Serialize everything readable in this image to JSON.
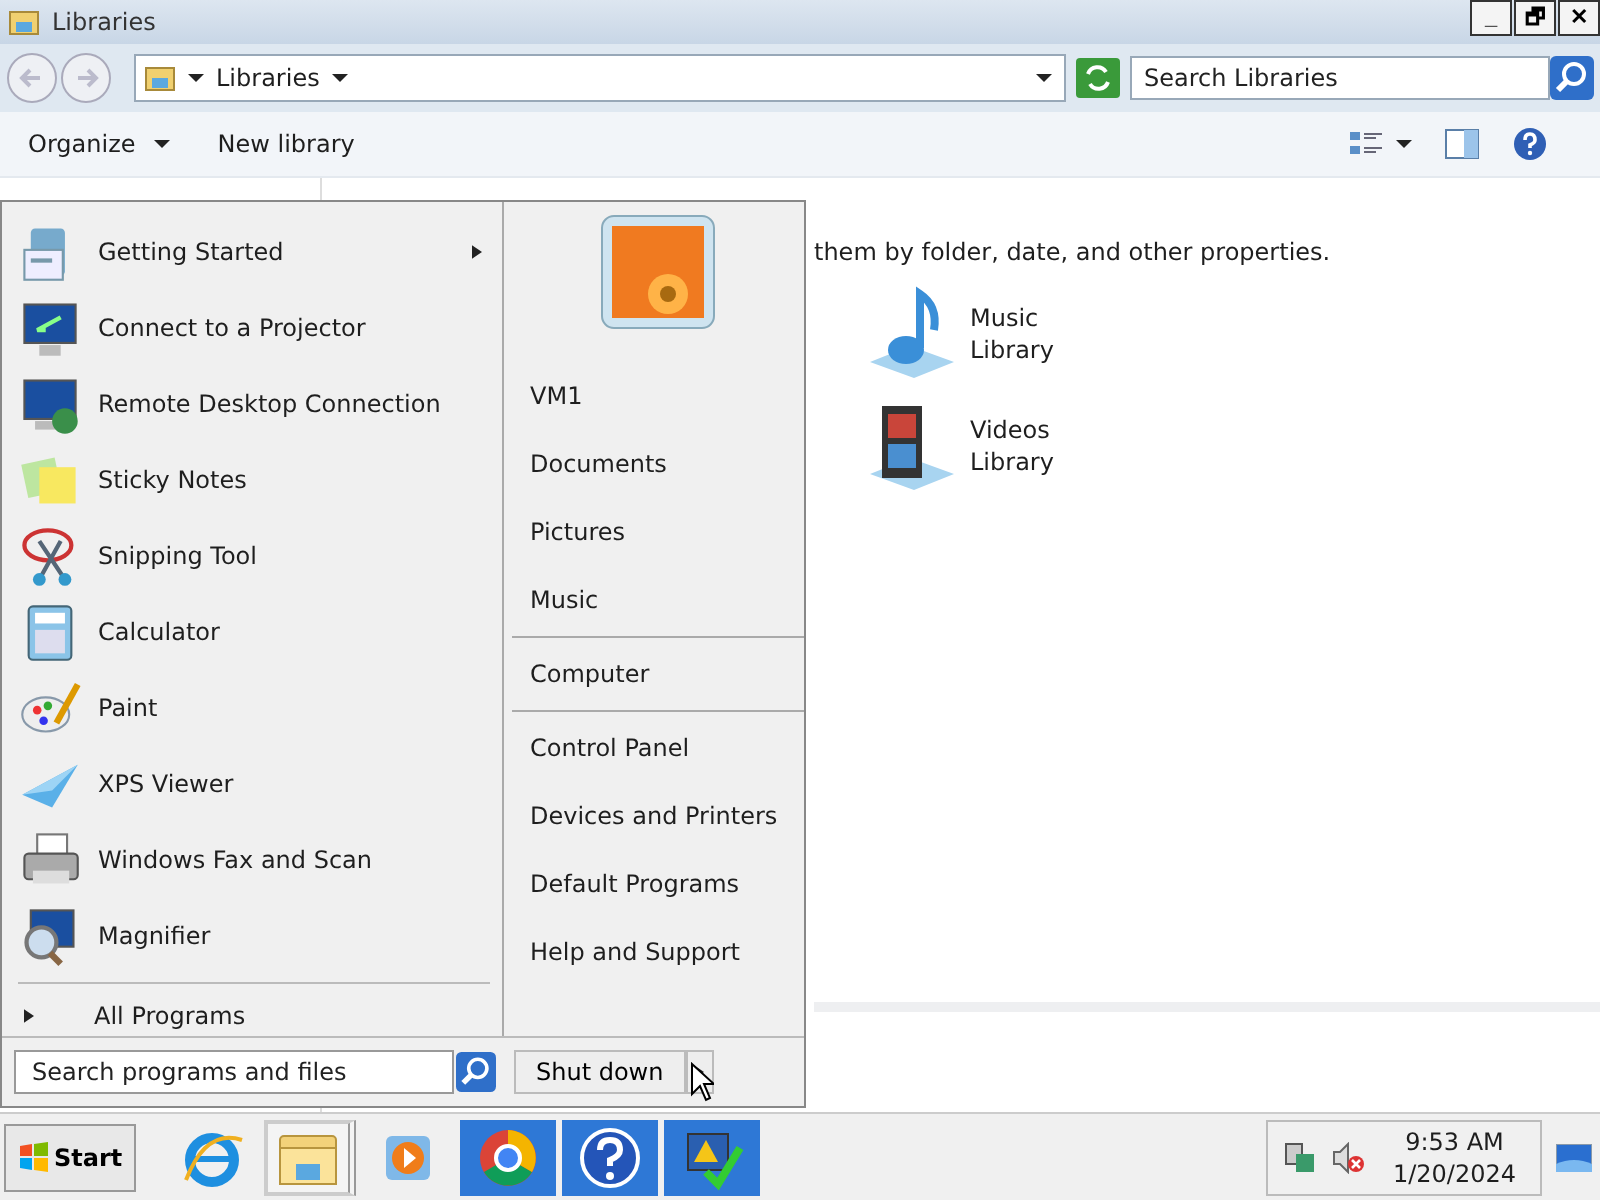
{
  "window": {
    "title": "Libraries",
    "controls": [
      "_",
      "🗗",
      "✕"
    ]
  },
  "address_bar": {
    "path": "Libraries",
    "search": {
      "placeholder": "Search Libraries"
    }
  },
  "toolbar": {
    "buttons": [
      {
        "label": "Organize",
        "dropdown": true
      },
      {
        "label": "New library",
        "dropdown": false
      }
    ]
  },
  "content": {
    "description": "them by folder, date, and other properties.",
    "libraries": [
      {
        "name": "Music",
        "subtitle": "Library"
      },
      {
        "name": "Videos",
        "subtitle": "Library"
      }
    ]
  },
  "start_menu": {
    "programs": [
      {
        "label": "Getting Started",
        "submenu": true
      },
      {
        "label": "Connect to a Projector",
        "submenu": false
      },
      {
        "label": "Remote Desktop Connection",
        "submenu": false
      },
      {
        "label": "Sticky Notes",
        "submenu": false
      },
      {
        "label": "Snipping Tool",
        "submenu": false
      },
      {
        "label": "Calculator",
        "submenu": false
      },
      {
        "label": "Paint",
        "submenu": false
      },
      {
        "label": "XPS Viewer",
        "submenu": false
      },
      {
        "label": "Windows Fax and Scan",
        "submenu": false
      },
      {
        "label": "Magnifier",
        "submenu": false
      }
    ],
    "all_programs": "All Programs",
    "search": {
      "placeholder": "Search programs and files"
    },
    "right_groups": [
      [
        "VM1",
        "Documents",
        "Pictures",
        "Music"
      ],
      [
        "Computer"
      ],
      [
        "Control Panel",
        "Devices and Printers",
        "Default Programs",
        "Help and Support"
      ]
    ],
    "shutdown": "Shut down"
  },
  "taskbar": {
    "start": "Start",
    "buttons": [
      {
        "kind": "plain"
      },
      {
        "kind": "window"
      },
      {
        "kind": "plain"
      },
      {
        "kind": "highlighted"
      },
      {
        "kind": "highlighted"
      },
      {
        "kind": "highlighted"
      }
    ],
    "time": "9:53 AM",
    "date": "1/20/2024"
  }
}
